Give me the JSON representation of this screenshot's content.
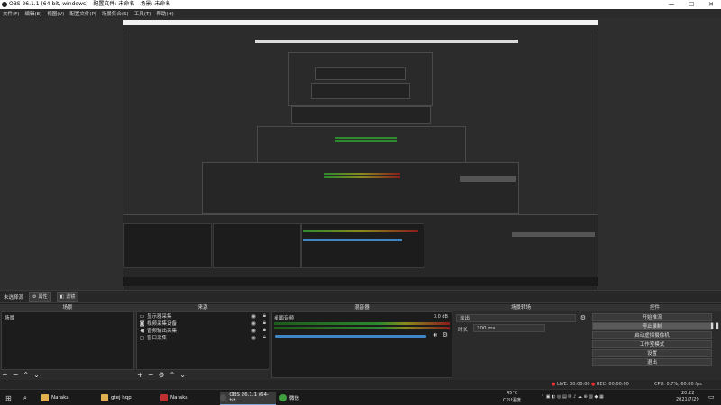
{
  "window": {
    "title": "OBS 26.1.1 (64-bit, windows) - 配置文件: 未命名 - 场景: 未命名",
    "controls": [
      "—",
      "☐",
      "✕"
    ]
  },
  "menu": [
    "文件(F)",
    "编辑(E)",
    "视图(V)",
    "配置文件(P)",
    "场景集合(S)",
    "工具(T)",
    "帮助(H)"
  ],
  "scenebar": {
    "no_scene": "未选择源",
    "properties": "属性",
    "filters": "滤镜"
  },
  "scenes": {
    "header": "场景",
    "items": [
      "场景"
    ]
  },
  "sources": {
    "header": "来源",
    "items": [
      {
        "icon": "monitor-icon",
        "label": "显示器采集"
      },
      {
        "icon": "camera-icon",
        "label": "视频采集设备"
      },
      {
        "icon": "speaker-icon",
        "label": "音频输出采集"
      },
      {
        "icon": "window-icon",
        "label": "窗口采集"
      }
    ]
  },
  "mixer": {
    "header": "混音器",
    "channel": "桌面音频",
    "level": "0.0 dB"
  },
  "transitions": {
    "header": "场景转场",
    "type": "淡出",
    "duration_label": "时长",
    "duration_value": "300 ms"
  },
  "controls": {
    "header": "控件",
    "buttons": [
      "开始推流",
      "停止录制",
      "启动虚拟摄像机",
      "工作室模式",
      "设置",
      "退出"
    ]
  },
  "status": {
    "live": "LIVE: 00:00:00",
    "rec": "REC: 00:00:00",
    "cpu": "CPU: 0.7%, 60.00 fps"
  },
  "taskbar": {
    "items": [
      {
        "label": "Naraka",
        "color": "#e0b050"
      },
      {
        "label": "gtej hqp",
        "color": "#e0b050"
      },
      {
        "label": "Naraka",
        "color": "#c03030"
      },
      {
        "label": "OBS 26.1.1 (64-bit...",
        "color": "#505050"
      },
      {
        "label": "微信",
        "color": "#40a040"
      }
    ],
    "weather_temp": "45°C",
    "weather_text": "CPU温度",
    "time": "20:22",
    "date": "2021/7/29"
  }
}
